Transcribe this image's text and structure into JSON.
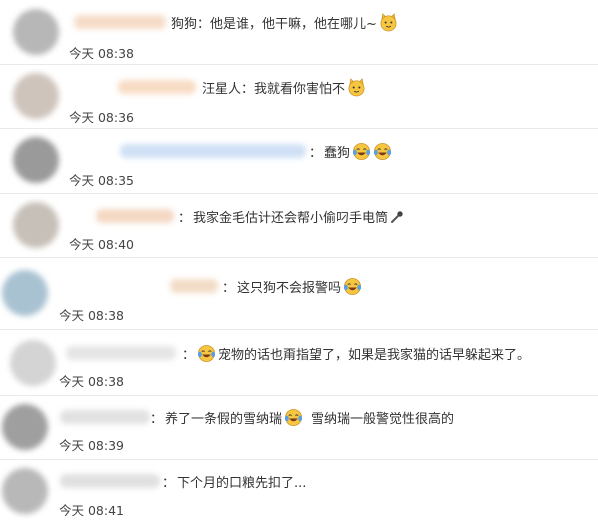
{
  "comments": [
    {
      "text": "狗狗：他是谁，他干嘛，他在哪儿~",
      "time": "今天 08:38",
      "avatar_color": "#b7b7b7",
      "name_color": "#f6dcc8",
      "emojis": [
        "cat-emoji"
      ]
    },
    {
      "text": "汪星人：我就看你害怕不",
      "time": "今天 08:36",
      "avatar_color": "#cfc4bc",
      "name_color": "#f8dcc4",
      "emojis": [
        "cat-emoji"
      ]
    },
    {
      "text": "蠢狗",
      "time": "今天 08:35",
      "avatar_color": "#9a9a9a",
      "name_color": "#cfe0f5",
      "emojis": [
        "laugh-cry-emoji",
        "laugh-cry-emoji"
      ]
    },
    {
      "text": "我家金毛估计还会帮小偷叼手电筒",
      "time": "今天 08:40",
      "avatar_color": "#c7c0b8",
      "name_color": "#f4d9c4",
      "emojis": [
        "microphone-icon"
      ]
    },
    {
      "text": "这只狗不会报警吗",
      "time": "今天 08:38",
      "avatar_color": "#a9c2d2",
      "name_color": "#f2dcc6",
      "emojis": [
        "laugh-cry-emoji"
      ]
    },
    {
      "text": "宠物的话也甭指望了，如果是我家猫的话早躲起来了。",
      "time": "今天 08:38",
      "avatar_color": "#d4d4d4",
      "name_color": "#e5e5e5",
      "emojis": [
        "laugh-cry-emoji"
      ]
    },
    {
      "text_before": "养了一条假的雪纳瑞",
      "text_after": "雪纳瑞一般警觉性很高的",
      "time": "今天 08:39",
      "avatar_color": "#9f9f9f",
      "name_color": "#e1e1e1",
      "emojis": [
        "laugh-cry-emoji"
      ]
    },
    {
      "text": "下个月的口粮先扣了...",
      "time": "今天 08:41",
      "avatar_color": "#b8b8b8",
      "name_color": "#e0e0e0",
      "emojis": []
    }
  ],
  "colors": {
    "emoji_yellow": "#f7c640",
    "emoji_tear": "#5aa0e0",
    "text": "#333333",
    "divider": "#e9e9e9"
  }
}
